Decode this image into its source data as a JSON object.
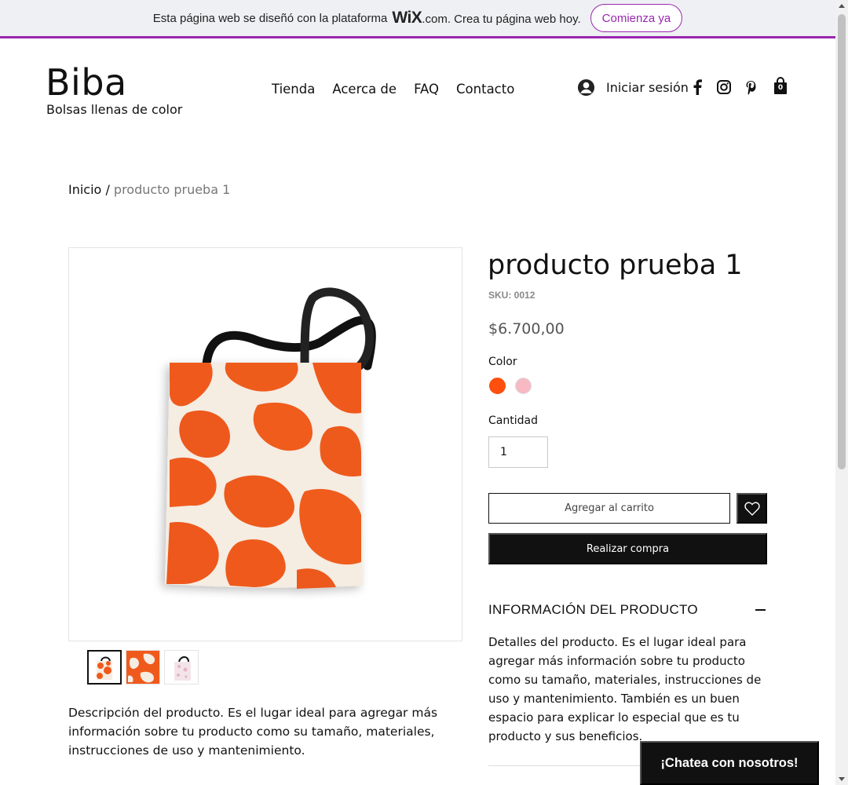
{
  "banner": {
    "text_before": "Esta página web se diseñó con la plataforma",
    "logo": "WiX",
    "text_after": ".com. Crea tu página web hoy.",
    "cta": "Comienza ya"
  },
  "header": {
    "brand": "Biba",
    "tagline": "Bolsas llenas de color",
    "nav": [
      "Tienda",
      "Acerca de",
      "FAQ",
      "Contacto"
    ],
    "login": "Iniciar sesión",
    "cart_count": "0"
  },
  "breadcrumb": {
    "home": "Inicio",
    "separator": "/",
    "current": "producto prueba 1"
  },
  "product": {
    "title": "producto prueba 1",
    "sku": "SKU: 0012",
    "price": "$6.700,00",
    "color_label": "Color",
    "colors": [
      "#ff4f0f",
      "#f7b9c4"
    ],
    "quantity_label": "Cantidad",
    "quantity": "1",
    "add_to_cart": "Agregar al carrito",
    "buy_now": "Realizar compra",
    "description": "Descripción del producto. Es el lugar ideal para agregar más información sobre tu producto como su tamaño, materiales, instrucciones de uso y mantenimiento.",
    "info_title": "INFORMACIÓN DEL PRODUCTO",
    "info_body": "Detalles del producto. Es el lugar ideal para agregar más información sobre tu producto como su tamaño, materiales, instrucciones de uso y mantenimiento. También es un buen espacio para explicar lo especial que es tu producto y sus beneficios."
  },
  "chat": {
    "label": "¡Chatea con nosotros!"
  },
  "colors": {
    "wix_purple": "#9a27b0",
    "accent_orange": "#ff4f0f"
  }
}
